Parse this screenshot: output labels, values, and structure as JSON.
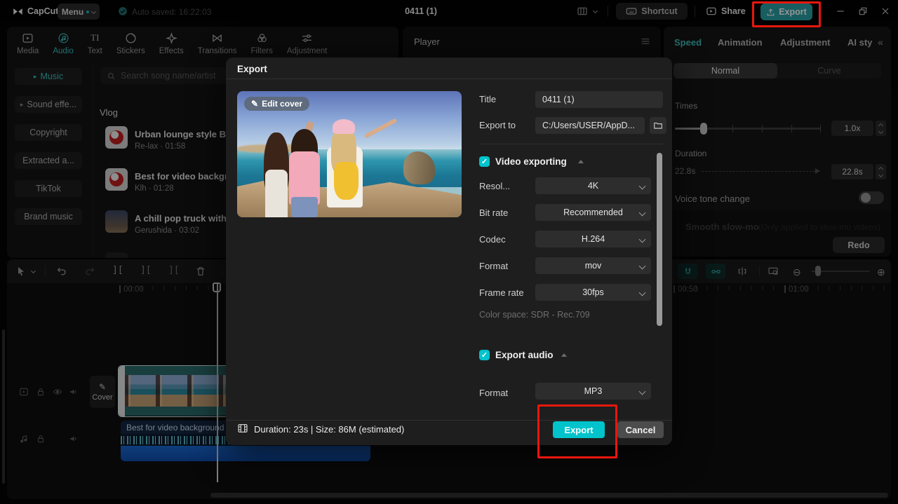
{
  "colors": {
    "accent": "#00c3cc",
    "teal": "#3fbfbf",
    "annotation_red": "#e8170d",
    "audio_clip_blue": "#1565d0"
  },
  "titlebar": {
    "logo": "CapCut",
    "menu": "Menu",
    "autosave": "Auto saved: 16:22:03",
    "project_title": "0411 (1)",
    "shortcut": "Shortcut",
    "share": "Share",
    "export": "Export"
  },
  "media_tabs": [
    {
      "label": "Media"
    },
    {
      "label": "Audio"
    },
    {
      "label": "Text"
    },
    {
      "label": "Stickers"
    },
    {
      "label": "Effects"
    },
    {
      "label": "Transitions"
    },
    {
      "label": "Filters"
    },
    {
      "label": "Adjustment"
    }
  ],
  "audio_sidebar": {
    "items": [
      {
        "label": "Music"
      },
      {
        "label": "Sound effe..."
      },
      {
        "label": "Copyright"
      },
      {
        "label": "Extracted a..."
      },
      {
        "label": "TikTok"
      },
      {
        "label": "Brand music"
      }
    ]
  },
  "music_panel": {
    "search_placeholder": "Search song name/artist",
    "section": "Vlog",
    "songs": [
      {
        "title": "Urban lounge style BG",
        "meta": "Re-lax · 01:58"
      },
      {
        "title": "Best for video backgr",
        "meta": "Klh · 01:28"
      },
      {
        "title": "A chill pop truck with",
        "meta": "Gerushida · 03:02"
      }
    ]
  },
  "player": {
    "title": "Player"
  },
  "export_dialog": {
    "title": "Export",
    "edit_cover": "Edit cover",
    "title_label": "Title",
    "title_value": "0411 (1)",
    "export_to_label": "Export to",
    "export_to_value": "C:/Users/USER/AppD...",
    "video_section": {
      "label": "Video exporting",
      "rows": [
        {
          "label": "Resol...",
          "value": "4K"
        },
        {
          "label": "Bit rate",
          "value": "Recommended"
        },
        {
          "label": "Codec",
          "value": "H.264"
        },
        {
          "label": "Format",
          "value": "mov"
        },
        {
          "label": "Frame rate",
          "value": "30fps"
        }
      ],
      "color_space": "Color space: SDR - Rec.709"
    },
    "audio_section": {
      "label": "Export audio",
      "format_label": "Format",
      "format_value": "MP3"
    },
    "footer": {
      "info": "Duration: 23s | Size: 86M (estimated)",
      "export": "Export",
      "cancel": "Cancel"
    }
  },
  "speed_panel": {
    "tabs": [
      {
        "label": "Speed"
      },
      {
        "label": "Animation"
      },
      {
        "label": "Adjustment"
      },
      {
        "label": "AI sty"
      }
    ],
    "mode_normal": "Normal",
    "mode_curve": "Curve",
    "times_label": "Times",
    "times_value": "1.0x",
    "duration_label": "Duration",
    "duration_start": "22.8s",
    "duration_value": "22.8s",
    "voice_tone": "Voice tone change",
    "slowmo_label": "Smooth slow-mo",
    "slowmo_hint": "(Only applied to slow-mo videos)",
    "redo": "Redo"
  },
  "timeline": {
    "ruler": [
      {
        "label": "00:00"
      },
      {
        "label": "00:50"
      },
      {
        "label": "01:00"
      }
    ],
    "cover": "Cover",
    "audio_clip_title": "Best for video background"
  }
}
